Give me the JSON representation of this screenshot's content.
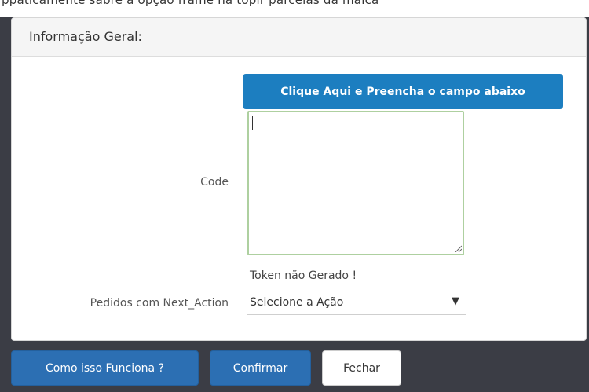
{
  "partial_top_text": "ppaticamente sabre a opção frame na topir parcelas da malca",
  "panel": {
    "title": "Informação Geral:"
  },
  "generate_button_label": "Clique Aqui e Preencha o campo abaixo",
  "code": {
    "label": "Code",
    "value": ""
  },
  "token_status": "Token não Gerado !",
  "next_action": {
    "label": "Pedidos com Next_Action",
    "selected": "Selecione a Ação"
  },
  "footer": {
    "how_label": "Como isso Funciona ?",
    "confirm_label": "Confirmar",
    "close_label": "Fechar"
  }
}
